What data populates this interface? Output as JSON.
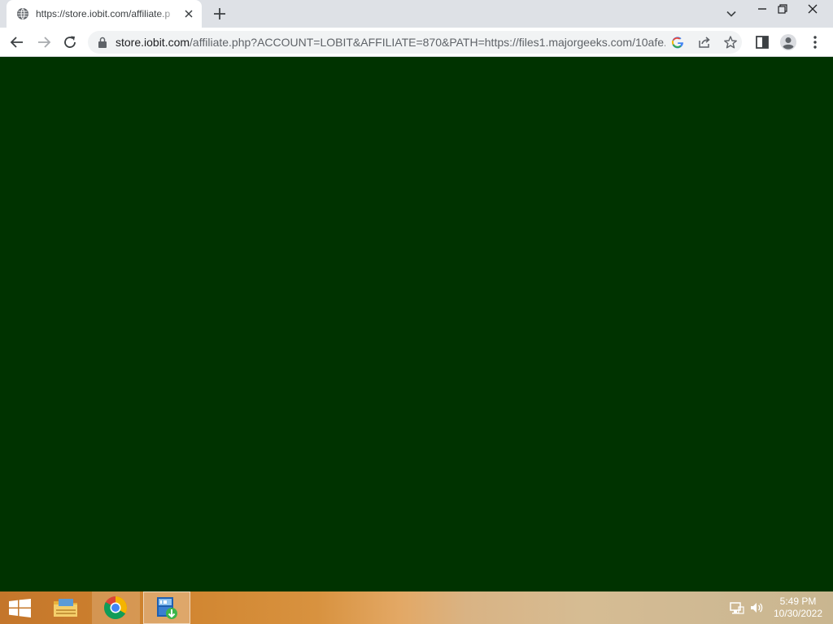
{
  "browser": {
    "tab": {
      "title": "https://store.iobit.com/affiliate.p",
      "icon": "globe-icon"
    },
    "omnibox": {
      "host": "store.iobit.com",
      "path": "/affiliate.php?ACCOUNT=LOBIT&AFFILIATE=870&PATH=https://files1.majorgeeks.com/10afe...",
      "secure_icon": "lock-icon"
    },
    "toolbar_icons": [
      "back-arrow-icon",
      "forward-arrow-icon",
      "reload-icon",
      "google-lens-icon",
      "share-icon",
      "bookmark-star-icon",
      "side-panel-icon",
      "profile-avatar-icon",
      "menu-kebab-icon"
    ],
    "window_controls": [
      "minimize-icon",
      "restore-icon",
      "close-icon"
    ]
  },
  "page": {
    "background_color": "#003300"
  },
  "taskbar": {
    "pins": [
      {
        "name": "file-explorer",
        "icon": "folder-icon"
      },
      {
        "name": "chrome",
        "icon": "chrome-icon"
      },
      {
        "name": "iobit-installer",
        "icon": "iobit-icon"
      }
    ],
    "tray_icons": [
      "network-icon",
      "volume-icon"
    ],
    "clock": {
      "time": "5:49 PM",
      "date": "10/30/2022"
    }
  }
}
